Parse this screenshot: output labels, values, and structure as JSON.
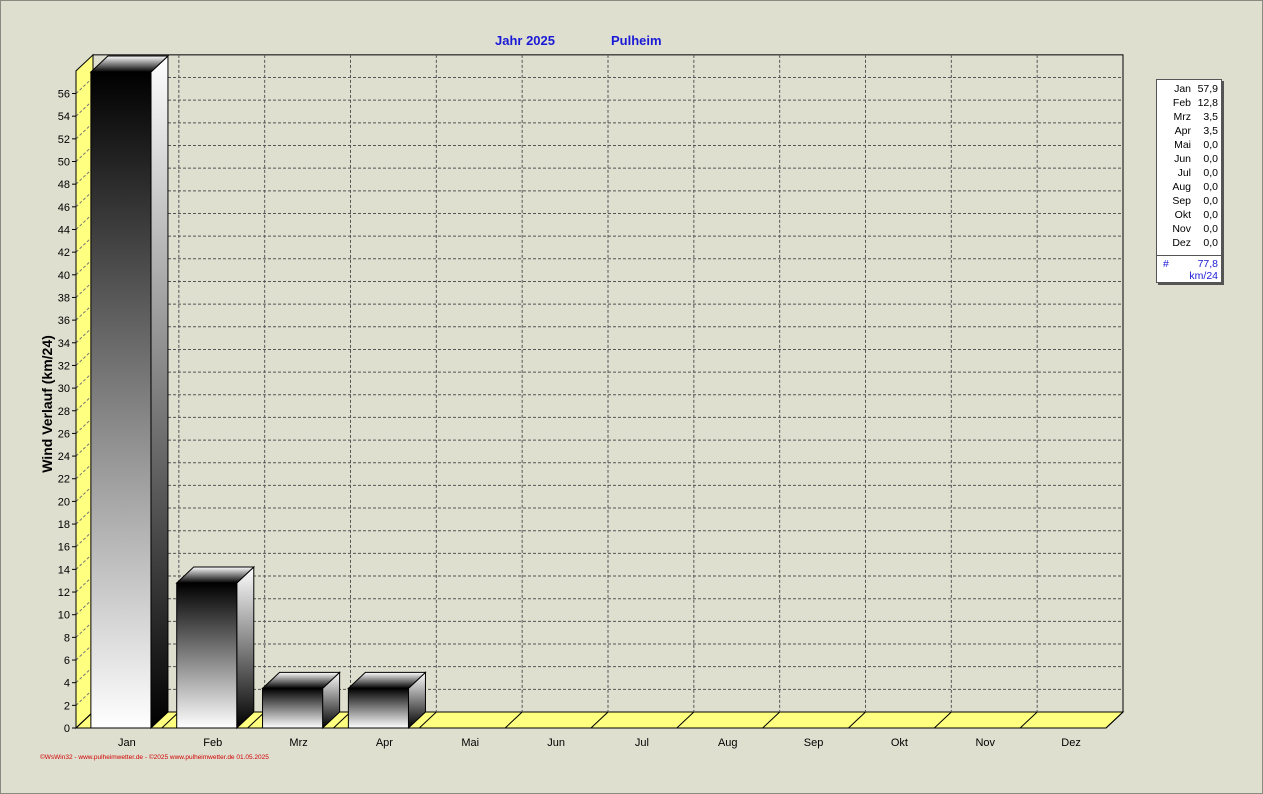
{
  "header": {
    "title_year": "Jahr  2025",
    "title_station": "Pulheim"
  },
  "chart_data": {
    "type": "bar",
    "categories": [
      "Jan",
      "Feb",
      "Mrz",
      "Apr",
      "Mai",
      "Jun",
      "Jul",
      "Aug",
      "Sep",
      "Okt",
      "Nov",
      "Dez"
    ],
    "values": [
      57.9,
      12.8,
      3.5,
      3.5,
      0.0,
      0.0,
      0.0,
      0.0,
      0.0,
      0.0,
      0.0,
      0.0
    ],
    "title": "Jahr  2025          Pulheim",
    "xlabel": "",
    "ylabel": "Wind Verlauf  (km/24)",
    "ylim": [
      0,
      58
    ],
    "yticks": [
      0,
      2,
      4,
      6,
      8,
      10,
      12,
      14,
      16,
      18,
      20,
      22,
      24,
      26,
      28,
      30,
      32,
      34,
      36,
      38,
      40,
      42,
      44,
      46,
      48,
      50,
      52,
      54,
      56
    ],
    "grid": true,
    "legend_position": "right"
  },
  "legend": {
    "rows": [
      {
        "month": "Jan",
        "value": "57,9"
      },
      {
        "month": "Feb",
        "value": "12,8"
      },
      {
        "month": "Mrz",
        "value": "3,5"
      },
      {
        "month": "Apr",
        "value": "3,5"
      },
      {
        "month": "Mai",
        "value": "0,0"
      },
      {
        "month": "Jun",
        "value": "0,0"
      },
      {
        "month": "Jul",
        "value": "0,0"
      },
      {
        "month": "Aug",
        "value": "0,0"
      },
      {
        "month": "Sep",
        "value": "0,0"
      },
      {
        "month": "Okt",
        "value": "0,0"
      },
      {
        "month": "Nov",
        "value": "0,0"
      },
      {
        "month": "Dez",
        "value": "0,0"
      }
    ],
    "total_symbol": "#",
    "total": "77,8",
    "unit": "km/24"
  },
  "footer": "©WsWin32 - www.pulheimwetter.de - ©2025 www.pulheimwetter.de  01.05.2025",
  "colors": {
    "background": "#dfdfd0",
    "side_wall": "#ffff80",
    "title": "#1a1ad6",
    "footer": "#d00000"
  }
}
